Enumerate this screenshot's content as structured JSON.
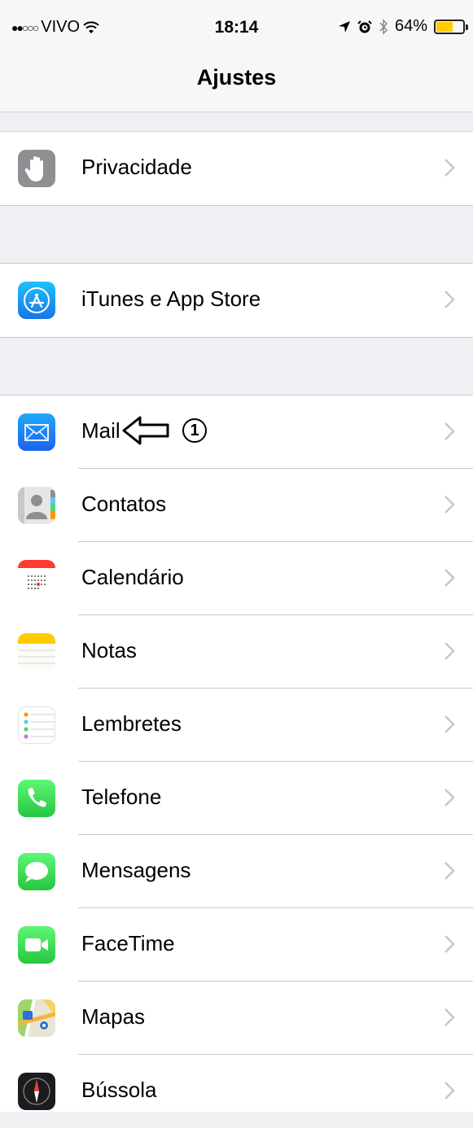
{
  "status_bar": {
    "carrier": "VIVO",
    "time": "18:14",
    "battery": "64%",
    "battery_level": 0.64,
    "icons": [
      "signal-dots-icon",
      "wifi-icon",
      "location-icon",
      "alarm-icon",
      "bluetooth-icon",
      "battery-icon"
    ]
  },
  "nav": {
    "title": "Ajustes"
  },
  "groups": [
    {
      "rows": [
        {
          "label": "Privacidade",
          "icon": "privacy-hand-icon"
        }
      ]
    },
    {
      "rows": [
        {
          "label": "iTunes e App Store",
          "icon": "app-store-icon"
        }
      ]
    },
    {
      "rows": [
        {
          "label": "Mail",
          "icon": "mail-icon"
        },
        {
          "label": "Contatos",
          "icon": "contacts-icon"
        },
        {
          "label": "Calendário",
          "icon": "calendar-icon"
        },
        {
          "label": "Notas",
          "icon": "notes-icon"
        },
        {
          "label": "Lembretes",
          "icon": "reminders-icon"
        },
        {
          "label": "Telefone",
          "icon": "phone-icon"
        },
        {
          "label": "Mensagens",
          "icon": "messages-icon"
        },
        {
          "label": "FaceTime",
          "icon": "facetime-icon"
        },
        {
          "label": "Mapas",
          "icon": "maps-icon"
        },
        {
          "label": "Bússola",
          "icon": "compass-icon"
        }
      ]
    }
  ],
  "annotation": {
    "number": "1",
    "arrow": "left-arrow-icon"
  },
  "colors": {
    "background": "#efeff4",
    "separator": "#c8c7cc",
    "battery": "#ffcc00"
  }
}
